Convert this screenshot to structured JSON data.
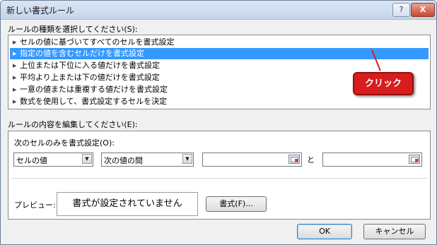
{
  "window": {
    "title": "新しい書式ルール",
    "help_label": "?",
    "close_label": "X"
  },
  "rule_type_section": {
    "label": "ルールの種類を選択してください(S):",
    "items": [
      "セルの値に基づいてすべてのセルを書式設定",
      "指定の値を含むセルだけを書式設定",
      "上位または下位に入る値だけを書式設定",
      "平均より上または下の値だけを書式設定",
      "一意の値または重複する値だけを書式設定",
      "数式を使用して、書式設定するセルを決定"
    ],
    "selected_index": 1
  },
  "annotation": {
    "label": "クリック"
  },
  "edit_section": {
    "label": "ルールの内容を編集してください(E):",
    "condition_label": "次のセルのみを書式設定(O):",
    "dropdown1": {
      "value": "セルの値"
    },
    "dropdown2": {
      "value": "次の値の間"
    },
    "value1": "",
    "connector": "と",
    "value2": "",
    "preview_label": "プレビュー:",
    "preview_text": "書式が設定されていません",
    "format_button": "書式(F)..."
  },
  "footer": {
    "ok_label": "OK",
    "cancel_label": "キャンセル"
  }
}
